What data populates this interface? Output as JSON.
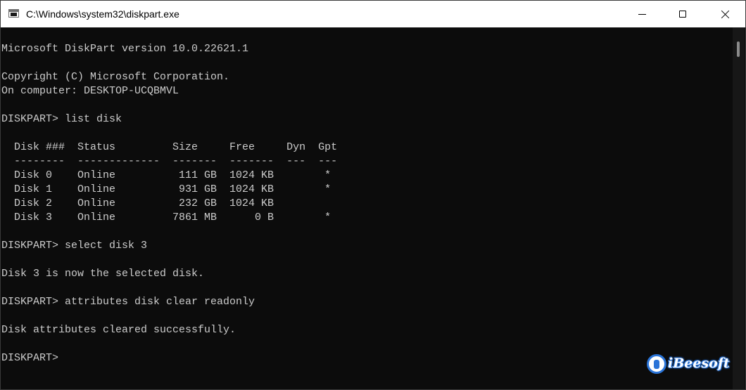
{
  "window": {
    "title": "C:\\Windows\\system32\\diskpart.exe",
    "buttons": {
      "minimize": "minimize-icon",
      "maximize": "maximize-icon",
      "close": "close-icon"
    }
  },
  "console": {
    "lines": [
      "Microsoft DiskPart version 10.0.22621.1",
      "",
      "Copyright (C) Microsoft Corporation.",
      "On computer: DESKTOP-UCQBMVL",
      "",
      "DISKPART> list disk",
      "",
      "  Disk ###  Status         Size     Free     Dyn  Gpt",
      "  --------  -------------  -------  -------  ---  ---",
      "  Disk 0    Online          111 GB  1024 KB        *",
      "  Disk 1    Online          931 GB  1024 KB        *",
      "  Disk 2    Online          232 GB  1024 KB",
      "  Disk 3    Online         7861 MB      0 B        *",
      "",
      "DISKPART> select disk 3",
      "",
      "Disk 3 is now the selected disk.",
      "",
      "DISKPART> attributes disk clear readonly",
      "",
      "Disk attributes cleared successfully.",
      "",
      "DISKPART> "
    ]
  },
  "watermark": {
    "text": "iBeesoft"
  },
  "colors": {
    "console_bg": "#0c0c0c",
    "console_fg": "#cccccc",
    "titlebar_bg": "#ffffff",
    "watermark_accent": "#2a74d8"
  }
}
